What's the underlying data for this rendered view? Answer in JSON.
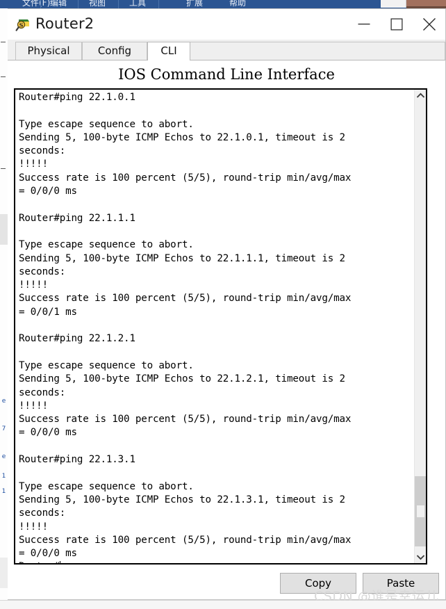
{
  "background": {
    "menubar_items": [
      "文件(F)",
      "编辑",
      "视图",
      "工具",
      "扩展",
      "帮助"
    ],
    "left_strip_glyphs": [
      "e",
      "7",
      "e",
      "1",
      "1"
    ]
  },
  "window": {
    "title": "Router2",
    "icon": "router-magnifier-icon",
    "controls": {
      "minimize": "minimize-icon",
      "maximize": "maximize-icon",
      "close": "close-icon"
    }
  },
  "tabs": [
    {
      "label": "Physical",
      "active": false
    },
    {
      "label": "Config",
      "active": false
    },
    {
      "label": "CLI",
      "active": true
    }
  ],
  "heading": "IOS Command Line Interface",
  "terminal": {
    "prompt": "Router#",
    "lines": [
      "Router#ping 22.1.0.1",
      "",
      "Type escape sequence to abort.",
      "Sending 5, 100-byte ICMP Echos to 22.1.0.1, timeout is 2",
      "seconds:",
      "!!!!!",
      "Success rate is 100 percent (5/5), round-trip min/avg/max",
      "= 0/0/0 ms",
      "",
      "Router#ping 22.1.1.1",
      "",
      "Type escape sequence to abort.",
      "Sending 5, 100-byte ICMP Echos to 22.1.1.1, timeout is 2",
      "seconds:",
      "!!!!!",
      "Success rate is 100 percent (5/5), round-trip min/avg/max",
      "= 0/0/1 ms",
      "",
      "Router#ping 22.1.2.1",
      "",
      "Type escape sequence to abort.",
      "Sending 5, 100-byte ICMP Echos to 22.1.2.1, timeout is 2",
      "seconds:",
      "!!!!!",
      "Success rate is 100 percent (5/5), round-trip min/avg/max",
      "= 0/0/0 ms",
      "",
      "Router#ping 22.1.3.1",
      "",
      "Type escape sequence to abort.",
      "Sending 5, 100-byte ICMP Echos to 22.1.3.1, timeout is 2",
      "seconds:",
      "!!!!!",
      "Success rate is 100 percent (5/5), round-trip min/avg/max",
      "= 0/0/0 ms",
      ""
    ],
    "scrollbar": {
      "up_arrow": "chevron-up-icon",
      "down_arrow": "chevron-down-icon"
    }
  },
  "footer": {
    "copy_label": "Copy",
    "paste_label": "Paste"
  },
  "watermark": "CSDN @谁是幸运儿",
  "colors": {
    "menubar_blue": "#2b5592",
    "button_face": "#e1e1e1",
    "scroll_thumb": "#cdcdcd",
    "watermark_gray": "#d9d9d9"
  }
}
